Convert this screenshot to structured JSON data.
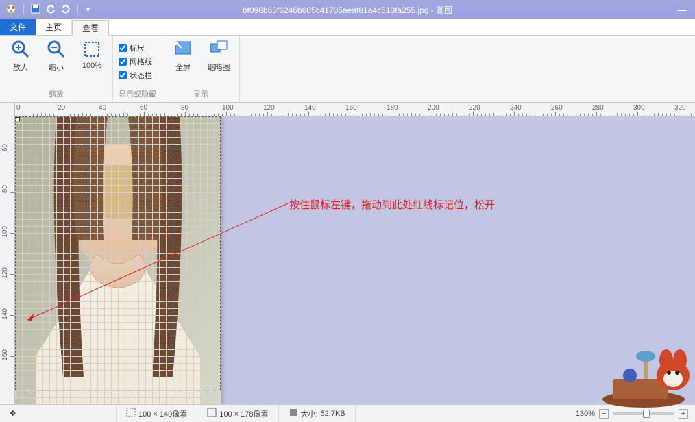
{
  "title": "bf096b63f6246b605c41705aeaf81a4c510fa255.jpg - 画图",
  "menu": {
    "file": "文件",
    "home": "主页",
    "view": "查看"
  },
  "ribbon": {
    "zoom": {
      "in": "放大",
      "out": "缩小",
      "hundred": "100%",
      "group": "缩放"
    },
    "show": {
      "ruler": "标尺",
      "grid": "网格线",
      "status": "状态栏",
      "group": "显示或隐藏"
    },
    "display": {
      "fullscreen": "全屏",
      "thumb": "缩略图",
      "group": "显示"
    }
  },
  "ruler_h": [
    "0",
    "20",
    "40",
    "60",
    "80",
    "100",
    "120",
    "140",
    "160",
    "180",
    "200",
    "220",
    "240",
    "260",
    "280",
    "300",
    "320"
  ],
  "ruler_v": [
    "60",
    "80",
    "100",
    "120",
    "140",
    "160"
  ],
  "annotation": "按住鼠标左键，拖动到此处红线标记位，松开",
  "status": {
    "sel_size": "100 × 140像素",
    "canvas_size": "100 × 178像素",
    "file_size_label": "大小:",
    "file_size": "52.7KB",
    "zoom": "130%"
  }
}
